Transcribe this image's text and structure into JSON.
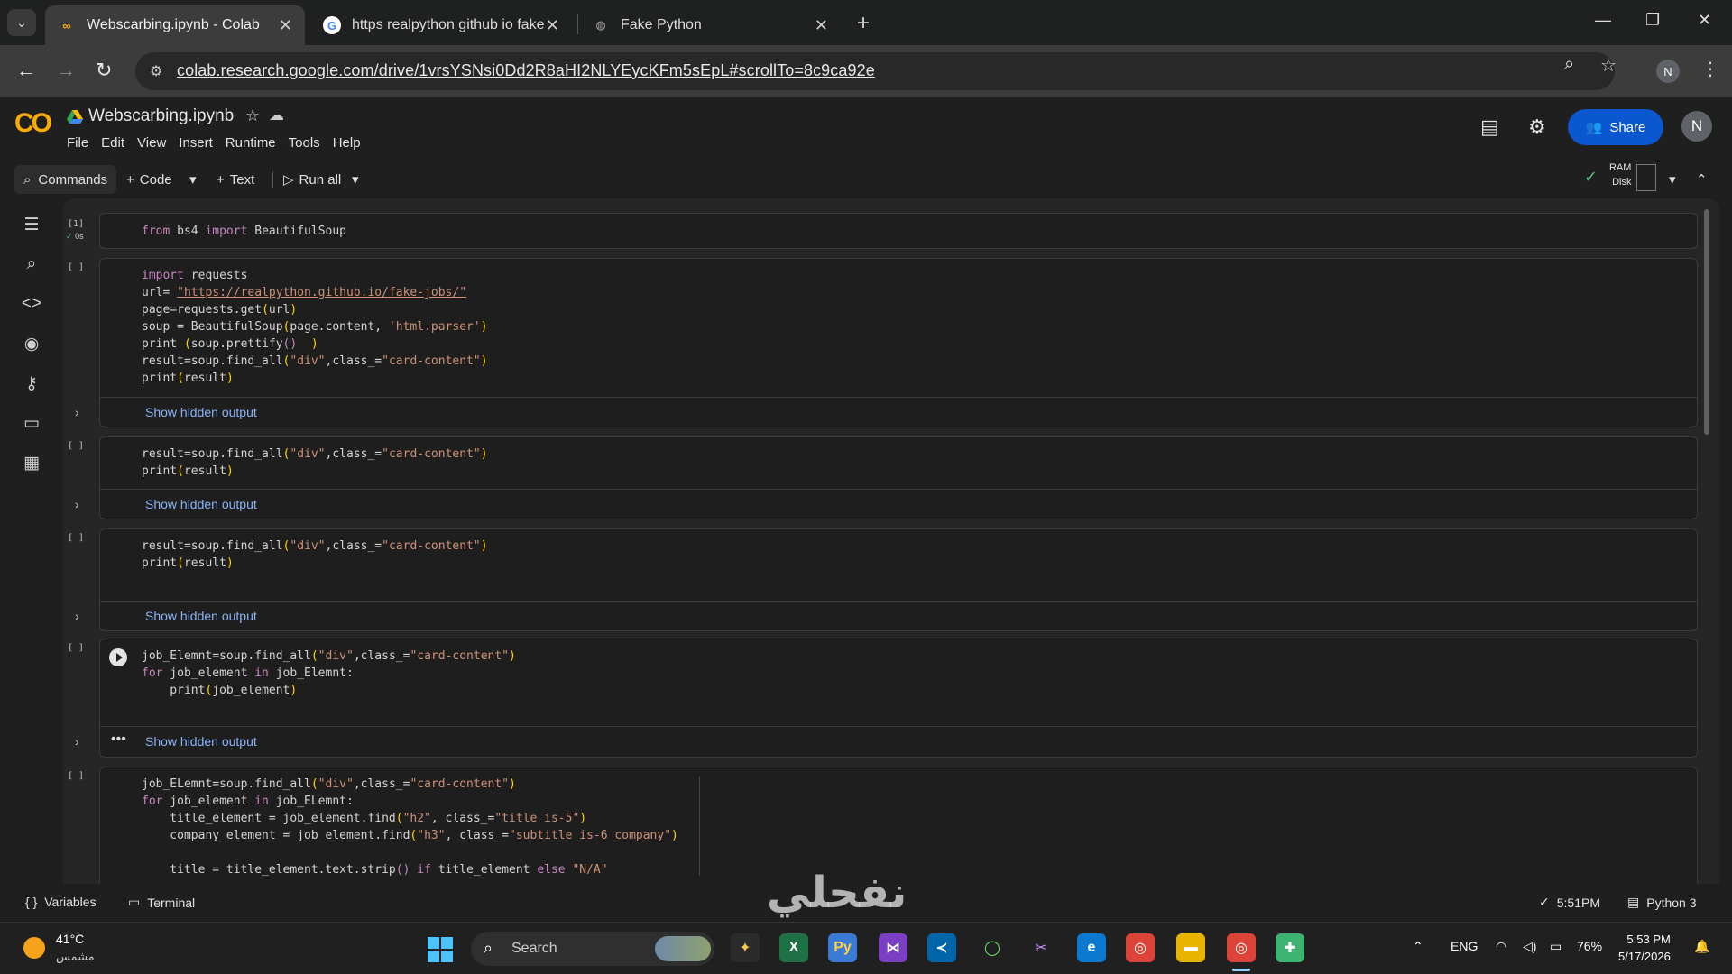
{
  "browser": {
    "tabs": [
      {
        "title": "Webscarbing.ipynb - Colab",
        "active": true,
        "favicon": "colab-icon"
      },
      {
        "title": "https realpython github io fake",
        "active": false,
        "favicon": "google-icon"
      },
      {
        "title": "Fake Python",
        "active": false,
        "favicon": "globe-icon"
      }
    ],
    "url": "colab.research.google.com/drive/1vrsYSNsi0Dd2R8aHI2NLYEycKFm5sEpL#scrollTo=8c9ca92e",
    "profile_initial": "N"
  },
  "colab": {
    "logo": "CO",
    "notebook_title": "Webscarbing.ipynb",
    "menu": [
      "File",
      "Edit",
      "View",
      "Insert",
      "Runtime",
      "Tools",
      "Help"
    ],
    "share_label": "Share",
    "avatar_initial": "N",
    "toolbar": {
      "commands": "Commands",
      "code": "Code",
      "text": "Text",
      "run_all": "Run all",
      "ram": "RAM",
      "disk": "Disk"
    },
    "rail_icons": [
      "toc-icon",
      "find-icon",
      "code-snippets-icon",
      "variables-inspector-icon",
      "secrets-key-icon",
      "files-folder-icon",
      "data-table-icon"
    ]
  },
  "cells": [
    {
      "exec": "[1]",
      "status": "0s"
    },
    {
      "exec": "[ ]",
      "output": "Show hidden output"
    },
    {
      "exec": "[ ]",
      "output": "Show hidden output"
    },
    {
      "exec": "[ ]",
      "output": "Show hidden output"
    },
    {
      "exec": "[ ]",
      "output": "Show hidden output"
    },
    {
      "exec": "[ ]"
    }
  ],
  "statusbar": {
    "variables": "Variables",
    "terminal": "Terminal",
    "time": "5:51PM",
    "runtime": "Python 3"
  },
  "watermark": "نفحلي",
  "taskbar": {
    "temp": "41°C",
    "weather_desc": "مشمس",
    "search": "Search",
    "lang": "ENG",
    "battery": "76%",
    "clock_time": "5:53 PM",
    "clock_date": "5/17/2026"
  }
}
